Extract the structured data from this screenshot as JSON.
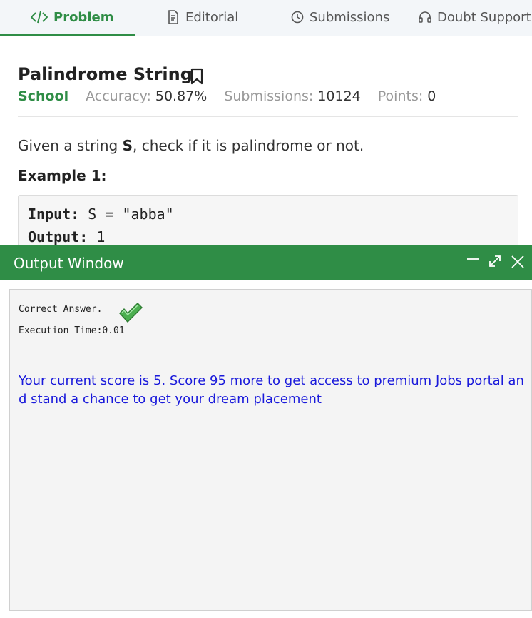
{
  "tabs": [
    {
      "label": "Problem",
      "icon": "code-icon"
    },
    {
      "label": "Editorial",
      "icon": "document-icon"
    },
    {
      "label": "Submissions",
      "icon": "clock-icon"
    },
    {
      "label": "Doubt Support",
      "icon": "headset-icon"
    }
  ],
  "problem": {
    "title": "Palindrome String",
    "difficulty": "School",
    "accuracy_label": "Accuracy:",
    "accuracy_value": "50.87%",
    "submissions_label": "Submissions:",
    "submissions_value": "10124",
    "points_label": "Points:",
    "points_value": "0",
    "statement_pre": "Given a string ",
    "statement_var": "S",
    "statement_post": ", check if it is palindrome or not.",
    "example_heading": "Example 1:",
    "example_input_label": "Input:",
    "example_input_value": " S = \"abba\"",
    "example_output_label": "Output:",
    "example_output_value": " 1"
  },
  "output_window": {
    "title": "Output Window",
    "result": "Correct Answer.",
    "execution_time": "Execution Time:0.01",
    "score_message": "Your current score is 5. Score 95 more to get access to premium Jobs portal and stand a chance to get your dream placement"
  },
  "colors": {
    "brand_green": "#2f8d46",
    "score_text": "#1a1adb"
  }
}
